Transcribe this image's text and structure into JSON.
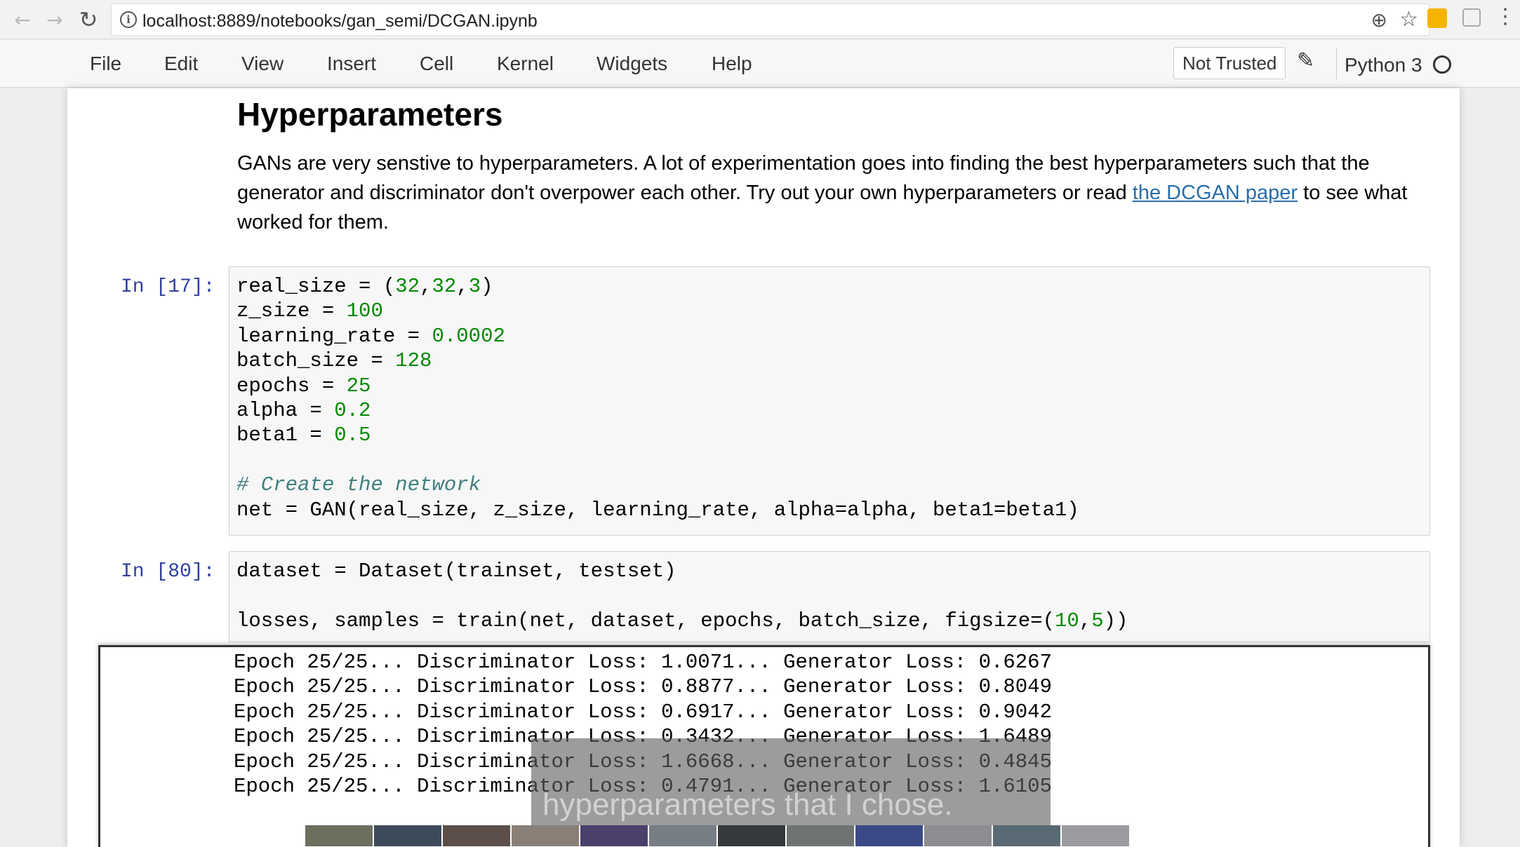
{
  "browser": {
    "url": "localhost:8889/notebooks/gan_semi/DCGAN.ipynb",
    "icons": [
      "back-arrow-icon",
      "forward-arrow-icon",
      "reload-icon",
      "info-icon",
      "zoom-icon",
      "star-icon",
      "extension-icon",
      "menu-dots-icon"
    ]
  },
  "menubar": {
    "items": [
      "File",
      "Edit",
      "View",
      "Insert",
      "Cell",
      "Kernel",
      "Widgets",
      "Help"
    ],
    "trust": "Not Trusted",
    "kernel": "Python 3"
  },
  "markdown": {
    "heading": "Hyperparameters",
    "para_before": "GANs are very senstive to hyperparameters. A lot of experimentation goes into finding the best hyperparameters such that the generator and discriminator don't overpower each other. Try out your own hyperparameters or read ",
    "link": "the DCGAN paper",
    "para_after": " to see what worked for them."
  },
  "cells": {
    "c17": {
      "prompt": "In [17]:",
      "lines": [
        [
          "real_size = (",
          "32",
          ",",
          "32",
          ",",
          "3",
          ")"
        ],
        [
          "z_size = ",
          "100"
        ],
        [
          "learning_rate = ",
          "0.0002"
        ],
        [
          "batch_size = ",
          "128"
        ],
        [
          "epochs = ",
          "25"
        ],
        [
          "alpha = ",
          "0.2"
        ],
        [
          "beta1 = ",
          "0.5"
        ],
        [
          ""
        ],
        [
          "# Create the network"
        ],
        [
          "net = GAN(real_size, z_size, learning_rate, alpha=alpha, beta1=beta1)"
        ]
      ]
    },
    "c80": {
      "prompt": "In [80]:",
      "lines": [
        [
          "dataset = Dataset(trainset, testset)"
        ],
        [
          ""
        ],
        [
          "losses, samples = train(net, dataset, epochs, batch_size, figsize=(",
          "10",
          ",",
          "5",
          "))"
        ]
      ]
    }
  },
  "output": {
    "lines": [
      "Epoch 25/25... Discriminator Loss: 1.0071... Generator Loss: 0.6267",
      "Epoch 25/25... Discriminator Loss: 0.8877... Generator Loss: 0.8049",
      "Epoch 25/25... Discriminator Loss: 0.6917... Generator Loss: 0.9042",
      "Epoch 25/25... Discriminator Loss: 0.3432... Generator Loss: 1.6489",
      "Epoch 25/25... Discriminator Loss: 1.6668... Generator Loss: 0.4845",
      "Epoch 25/25... Discriminator Loss: 0.4791... Generator Loss: 1.6105"
    ],
    "subtitle": "hyperparameters that I chose."
  },
  "colors": {
    "number": "#008800",
    "comment": "#408080",
    "prompt": "#303f9f",
    "link": "#296eaa"
  }
}
